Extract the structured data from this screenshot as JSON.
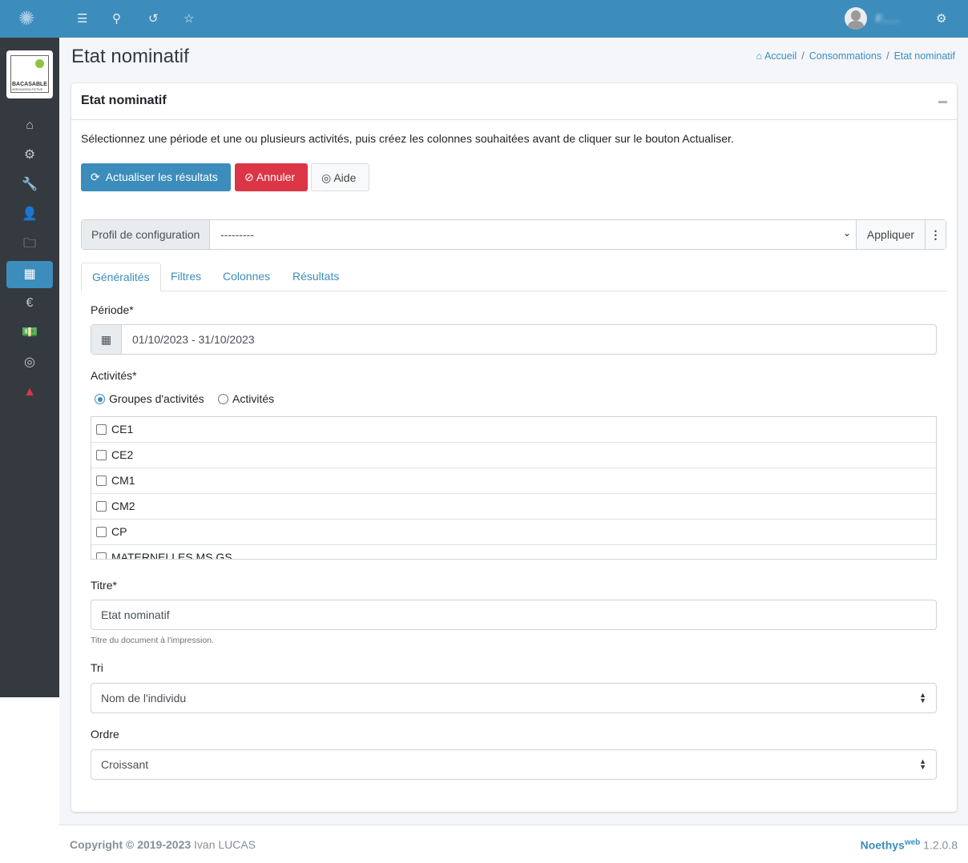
{
  "topbar": {
    "icons": [
      "network-logo-icon",
      "bars-icon",
      "search-icon",
      "history-icon",
      "star-icon"
    ],
    "user_name": "F......",
    "settings_icon": "cogs-icon"
  },
  "sidebar": {
    "logo_text": "BACASABLE",
    "logo_sub": "ASSOCIATION FICTIVE",
    "items": [
      {
        "icon": "home-icon",
        "glyph": "⌂"
      },
      {
        "icon": "gear-icon",
        "glyph": "⚙"
      },
      {
        "icon": "wrench-icon",
        "glyph": "🔧"
      },
      {
        "icon": "user-icon",
        "glyph": "👤"
      },
      {
        "icon": "folder-icon",
        "glyph": "🗀"
      },
      {
        "icon": "calendar-icon",
        "glyph": "▦"
      },
      {
        "icon": "euro-icon",
        "glyph": "€"
      },
      {
        "icon": "money-icon",
        "glyph": "💵"
      },
      {
        "icon": "lifebuoy-icon",
        "glyph": "◎"
      },
      {
        "icon": "warning-icon",
        "glyph": "▲"
      }
    ]
  },
  "page": {
    "title": "Etat nominatif",
    "breadcrumb": [
      "Accueil",
      "Consommations",
      "Etat nominatif"
    ]
  },
  "card": {
    "title": "Etat nominatif",
    "intro": "Sélectionnez une période et une ou plusieurs activités, puis créez les colonnes souhaitées avant de cliquer sur le bouton Actualiser.",
    "buttons": {
      "refresh": "Actualiser les résultats",
      "cancel": "Annuler",
      "help": "Aide"
    },
    "profile": {
      "label": "Profil de configuration",
      "value": "---------",
      "apply": "Appliquer"
    },
    "tabs": [
      "Généralités",
      "Filtres",
      "Colonnes",
      "Résultats"
    ],
    "periode": {
      "label": "Période*",
      "value": "01/10/2023 - 31/10/2023"
    },
    "activites": {
      "label": "Activités*",
      "radio_groups": "Groupes d'activités",
      "radio_activities": "Activités",
      "items": [
        "CE1",
        "CE2",
        "CM1",
        "CM2",
        "CP",
        "MATERNELLES MS GS"
      ]
    },
    "titre": {
      "label": "Titre*",
      "value": "Etat nominatif",
      "help": "Titre du document à l'impression."
    },
    "tri": {
      "label": "Tri",
      "value": "Nom de l'individu"
    },
    "ordre": {
      "label": "Ordre",
      "value": "Croissant"
    }
  },
  "footer": {
    "copyright": "Copyright © 2019-2023",
    "author": "Ivan LUCAS",
    "brand": "Noethys",
    "brand_sup": "web",
    "version": "1.2.0.8"
  },
  "colors": {
    "primary": "#3c8dbc",
    "danger": "#dc3545",
    "sidebar": "#343a40"
  }
}
